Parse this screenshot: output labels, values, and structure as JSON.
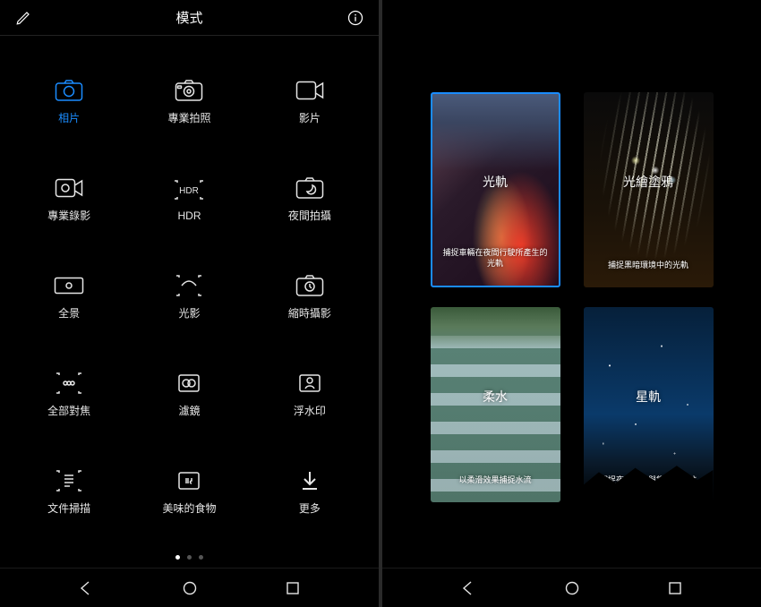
{
  "colors": {
    "accent": "#1a8cff"
  },
  "left": {
    "title": "模式",
    "modes": [
      {
        "label": "相片",
        "icon": "camera",
        "active": true
      },
      {
        "label": "專業拍照",
        "icon": "camera-pro"
      },
      {
        "label": "影片",
        "icon": "video"
      },
      {
        "label": "專業錄影",
        "icon": "video-pro"
      },
      {
        "label": "HDR",
        "icon": "hdr"
      },
      {
        "label": "夜間拍攝",
        "icon": "night"
      },
      {
        "label": "全景",
        "icon": "panorama"
      },
      {
        "label": "光影",
        "icon": "light-effect"
      },
      {
        "label": "縮時攝影",
        "icon": "timelapse"
      },
      {
        "label": "全部對焦",
        "icon": "all-focus"
      },
      {
        "label": "濾鏡",
        "icon": "filter"
      },
      {
        "label": "浮水印",
        "icon": "watermark"
      },
      {
        "label": "文件掃描",
        "icon": "doc-scan"
      },
      {
        "label": "美味的食物",
        "icon": "food"
      },
      {
        "label": "更多",
        "icon": "download"
      }
    ],
    "page_dots": {
      "count": 3,
      "active": 0
    }
  },
  "right": {
    "cards": [
      {
        "title": "光軌",
        "desc": "捕捉車輛在夜間行駛所產生的光軌",
        "bg": "bg-traffic",
        "selected": true
      },
      {
        "title": "光繪塗鴉",
        "desc": "捕捉黑暗環境中的光軌",
        "bg": "bg-lightpaint"
      },
      {
        "title": "柔水",
        "desc": "以柔滑效果捕捉水流",
        "bg": "bg-water"
      },
      {
        "title": "星軌",
        "desc": "捕捉夜空群星與銀河的軌跡",
        "bg": "bg-stars"
      }
    ]
  }
}
